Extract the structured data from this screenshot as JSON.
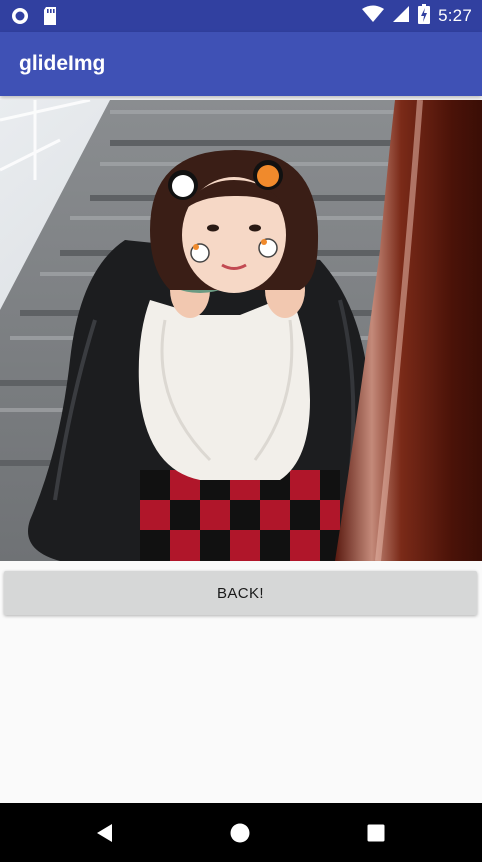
{
  "status_bar": {
    "time": "5:27",
    "left_icons": [
      "notification-circle-icon",
      "sd-card-icon"
    ],
    "right_icons": [
      "wifi-icon",
      "cell-signal-icon",
      "battery-charging-icon"
    ]
  },
  "app_bar": {
    "title": "glideImg"
  },
  "photo": {
    "subject": "photo"
  },
  "back_button": {
    "label": "BACK!"
  },
  "nav_bar": {
    "buttons": [
      "back-icon",
      "home-icon",
      "recents-icon"
    ]
  },
  "colors": {
    "status_bar": "#3140a0",
    "app_bar": "#3f51b5",
    "background": "#fafafa",
    "button": "#d6d7d7"
  }
}
